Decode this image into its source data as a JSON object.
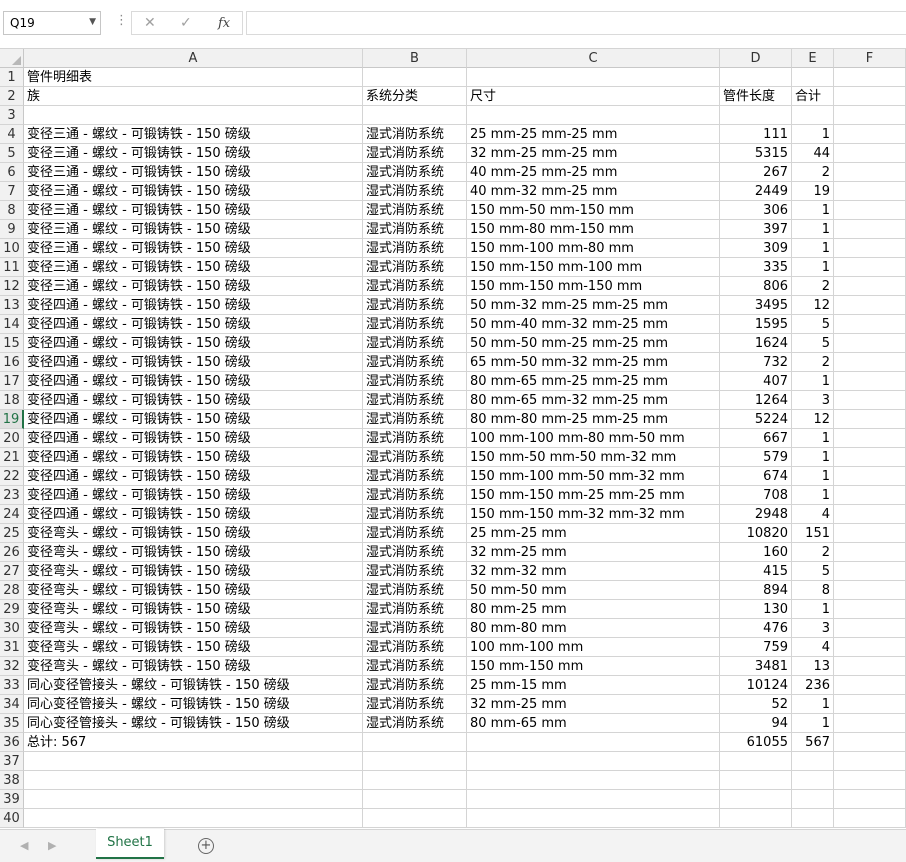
{
  "formula_bar": {
    "name_box": "Q19",
    "cancel_icon": "✕",
    "enter_icon": "✓",
    "fx_label": "fx",
    "formula": ""
  },
  "columns": [
    "A",
    "B",
    "C",
    "D",
    "E",
    "F"
  ],
  "selected_row": 19,
  "rows": [
    {
      "n": "1",
      "a": "管件明细表",
      "b": "",
      "c": "",
      "d": "",
      "e": ""
    },
    {
      "n": "2",
      "a": "族",
      "b": "系统分类",
      "c": "尺寸",
      "d": "管件长度",
      "e": "合计",
      "left": true
    },
    {
      "n": "3",
      "a": "",
      "b": "",
      "c": "",
      "d": "",
      "e": ""
    },
    {
      "n": "4",
      "a": "变径三通 - 螺纹 - 可锻铸铁 - 150 磅级",
      "b": "湿式消防系统",
      "c": "25 mm-25 mm-25 mm",
      "d": "111",
      "e": "1"
    },
    {
      "n": "5",
      "a": "变径三通 - 螺纹 - 可锻铸铁 - 150 磅级",
      "b": "湿式消防系统",
      "c": "32 mm-25 mm-25 mm",
      "d": "5315",
      "e": "44"
    },
    {
      "n": "6",
      "a": "变径三通 - 螺纹 - 可锻铸铁 - 150 磅级",
      "b": "湿式消防系统",
      "c": "40 mm-25 mm-25 mm",
      "d": "267",
      "e": "2"
    },
    {
      "n": "7",
      "a": "变径三通 - 螺纹 - 可锻铸铁 - 150 磅级",
      "b": "湿式消防系统",
      "c": "40 mm-32 mm-25 mm",
      "d": "2449",
      "e": "19"
    },
    {
      "n": "8",
      "a": "变径三通 - 螺纹 - 可锻铸铁 - 150 磅级",
      "b": "湿式消防系统",
      "c": "150 mm-50 mm-150 mm",
      "d": "306",
      "e": "1"
    },
    {
      "n": "9",
      "a": "变径三通 - 螺纹 - 可锻铸铁 - 150 磅级",
      "b": "湿式消防系统",
      "c": "150 mm-80 mm-150 mm",
      "d": "397",
      "e": "1"
    },
    {
      "n": "10",
      "a": "变径三通 - 螺纹 - 可锻铸铁 - 150 磅级",
      "b": "湿式消防系统",
      "c": "150 mm-100 mm-80 mm",
      "d": "309",
      "e": "1"
    },
    {
      "n": "11",
      "a": "变径三通 - 螺纹 - 可锻铸铁 - 150 磅级",
      "b": "湿式消防系统",
      "c": "150 mm-150 mm-100 mm",
      "d": "335",
      "e": "1"
    },
    {
      "n": "12",
      "a": "变径三通 - 螺纹 - 可锻铸铁 - 150 磅级",
      "b": "湿式消防系统",
      "c": "150 mm-150 mm-150 mm",
      "d": "806",
      "e": "2"
    },
    {
      "n": "13",
      "a": "变径四通 - 螺纹 - 可锻铸铁 - 150 磅级",
      "b": "湿式消防系统",
      "c": "50 mm-32 mm-25 mm-25 mm",
      "d": "3495",
      "e": "12"
    },
    {
      "n": "14",
      "a": "变径四通 - 螺纹 - 可锻铸铁 - 150 磅级",
      "b": "湿式消防系统",
      "c": "50 mm-40 mm-32 mm-25 mm",
      "d": "1595",
      "e": "5"
    },
    {
      "n": "15",
      "a": "变径四通 - 螺纹 - 可锻铸铁 - 150 磅级",
      "b": "湿式消防系统",
      "c": "50 mm-50 mm-25 mm-25 mm",
      "d": "1624",
      "e": "5"
    },
    {
      "n": "16",
      "a": "变径四通 - 螺纹 - 可锻铸铁 - 150 磅级",
      "b": "湿式消防系统",
      "c": "65 mm-50 mm-32 mm-25 mm",
      "d": "732",
      "e": "2"
    },
    {
      "n": "17",
      "a": "变径四通 - 螺纹 - 可锻铸铁 - 150 磅级",
      "b": "湿式消防系统",
      "c": "80 mm-65 mm-25 mm-25 mm",
      "d": "407",
      "e": "1"
    },
    {
      "n": "18",
      "a": "变径四通 - 螺纹 - 可锻铸铁 - 150 磅级",
      "b": "湿式消防系统",
      "c": "80 mm-65 mm-32 mm-25 mm",
      "d": "1264",
      "e": "3"
    },
    {
      "n": "19",
      "a": "变径四通 - 螺纹 - 可锻铸铁 - 150 磅级",
      "b": "湿式消防系统",
      "c": "80 mm-80 mm-25 mm-25 mm",
      "d": "5224",
      "e": "12"
    },
    {
      "n": "20",
      "a": "变径四通 - 螺纹 - 可锻铸铁 - 150 磅级",
      "b": "湿式消防系统",
      "c": "100 mm-100 mm-80 mm-50 mm",
      "d": "667",
      "e": "1"
    },
    {
      "n": "21",
      "a": "变径四通 - 螺纹 - 可锻铸铁 - 150 磅级",
      "b": "湿式消防系统",
      "c": "150 mm-50 mm-50 mm-32 mm",
      "d": "579",
      "e": "1"
    },
    {
      "n": "22",
      "a": "变径四通 - 螺纹 - 可锻铸铁 - 150 磅级",
      "b": "湿式消防系统",
      "c": "150 mm-100 mm-50 mm-32 mm",
      "d": "674",
      "e": "1"
    },
    {
      "n": "23",
      "a": "变径四通 - 螺纹 - 可锻铸铁 - 150 磅级",
      "b": "湿式消防系统",
      "c": "150 mm-150 mm-25 mm-25 mm",
      "d": "708",
      "e": "1"
    },
    {
      "n": "24",
      "a": "变径四通 - 螺纹 - 可锻铸铁 - 150 磅级",
      "b": "湿式消防系统",
      "c": "150 mm-150 mm-32 mm-32 mm",
      "d": "2948",
      "e": "4"
    },
    {
      "n": "25",
      "a": "变径弯头 - 螺纹 - 可锻铸铁 - 150 磅级",
      "b": "湿式消防系统",
      "c": "25 mm-25 mm",
      "d": "10820",
      "e": "151"
    },
    {
      "n": "26",
      "a": "变径弯头 - 螺纹 - 可锻铸铁 - 150 磅级",
      "b": "湿式消防系统",
      "c": "32 mm-25 mm",
      "d": "160",
      "e": "2"
    },
    {
      "n": "27",
      "a": "变径弯头 - 螺纹 - 可锻铸铁 - 150 磅级",
      "b": "湿式消防系统",
      "c": "32 mm-32 mm",
      "d": "415",
      "e": "5"
    },
    {
      "n": "28",
      "a": "变径弯头 - 螺纹 - 可锻铸铁 - 150 磅级",
      "b": "湿式消防系统",
      "c": "50 mm-50 mm",
      "d": "894",
      "e": "8"
    },
    {
      "n": "29",
      "a": "变径弯头 - 螺纹 - 可锻铸铁 - 150 磅级",
      "b": "湿式消防系统",
      "c": "80 mm-25 mm",
      "d": "130",
      "e": "1"
    },
    {
      "n": "30",
      "a": "变径弯头 - 螺纹 - 可锻铸铁 - 150 磅级",
      "b": "湿式消防系统",
      "c": "80 mm-80 mm",
      "d": "476",
      "e": "3"
    },
    {
      "n": "31",
      "a": "变径弯头 - 螺纹 - 可锻铸铁 - 150 磅级",
      "b": "湿式消防系统",
      "c": "100 mm-100 mm",
      "d": "759",
      "e": "4"
    },
    {
      "n": "32",
      "a": "变径弯头 - 螺纹 - 可锻铸铁 - 150 磅级",
      "b": "湿式消防系统",
      "c": "150 mm-150 mm",
      "d": "3481",
      "e": "13"
    },
    {
      "n": "33",
      "a": "同心变径管接头 - 螺纹 - 可锻铸铁 - 150 磅级",
      "b": "湿式消防系统",
      "c": "25 mm-15 mm",
      "d": "10124",
      "e": "236"
    },
    {
      "n": "34",
      "a": "同心变径管接头 - 螺纹 - 可锻铸铁 - 150 磅级",
      "b": "湿式消防系统",
      "c": "32 mm-25 mm",
      "d": "52",
      "e": "1"
    },
    {
      "n": "35",
      "a": "同心变径管接头 - 螺纹 - 可锻铸铁 - 150 磅级",
      "b": "湿式消防系统",
      "c": "80 mm-65 mm",
      "d": "94",
      "e": "1"
    },
    {
      "n": "36",
      "a": "总计: 567",
      "b": "",
      "c": "",
      "d": "61055",
      "e": "567"
    },
    {
      "n": "37",
      "a": "",
      "b": "",
      "c": "",
      "d": "",
      "e": ""
    },
    {
      "n": "38",
      "a": "",
      "b": "",
      "c": "",
      "d": "",
      "e": ""
    },
    {
      "n": "39",
      "a": "",
      "b": "",
      "c": "",
      "d": "",
      "e": ""
    },
    {
      "n": "40",
      "a": "",
      "b": "",
      "c": "",
      "d": "",
      "e": ""
    }
  ],
  "sheet_tabs": {
    "active": "Sheet1",
    "add_icon": "+",
    "prev_icon": "◀",
    "next_icon": "▶"
  },
  "colors": {
    "accent": "#217346"
  }
}
